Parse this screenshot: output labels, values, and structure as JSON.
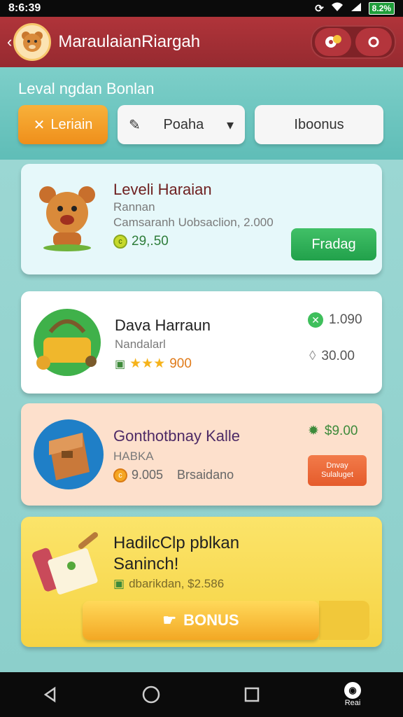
{
  "status": {
    "time": "8:6:39",
    "battery": "8.2%"
  },
  "header": {
    "title": "MaraulaianRiargah",
    "back_icon": "back-arrow-icon",
    "settings_icon": "gear-icon",
    "more_icon": "more-icon"
  },
  "section": {
    "title": "Leval ngdan Bonlan"
  },
  "filters": {
    "active_label": "Leriain",
    "select_label": "Poaha",
    "plain_label": "Iboonus"
  },
  "cards": [
    {
      "title": "Leveli Haraian",
      "sub1": "Rannan",
      "sub2": "Camsaranh Uobsaclion, 2.000",
      "value": "29,.50",
      "button": "Fradag"
    },
    {
      "title": "Dava Harraun",
      "sub1": "Nandalarl",
      "stars": "900",
      "price1": "1.090",
      "price2": "30.00"
    },
    {
      "title": "Gonthotbnay Kalle",
      "sub1": "HABKA",
      "value": "9.005",
      "value_label": "Brsaidano",
      "price": "$9.00",
      "button_line1": "Dnvay",
      "button_line2": "Sulaluget"
    },
    {
      "title_line1": "HadilcClp pblkan",
      "title_line2": "Saninch!",
      "sub1": "dbarikdan, $2.586",
      "button": "BONUS"
    }
  ],
  "nav": {
    "avatar_label": "Reai"
  },
  "colors": {
    "appbar": "#b0343a",
    "accent_orange": "#f3a824",
    "green": "#21a14b",
    "teal": "#8fd0cc"
  }
}
